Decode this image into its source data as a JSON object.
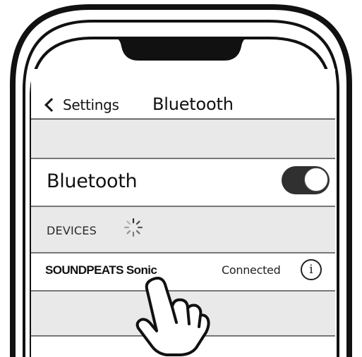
{
  "nav": {
    "back_label": "Settings",
    "title": "Bluetooth"
  },
  "bluetooth_toggle": {
    "label": "Bluetooth",
    "state": "on"
  },
  "devices_section": {
    "header": "DEVICES",
    "searching": true
  },
  "devices": [
    {
      "name": "SOUNDPEATS Sonic",
      "status": "Connected",
      "info_icon": "i"
    }
  ],
  "icons": {
    "back": "chevron-left-icon",
    "spinner": "loading-spinner-icon",
    "info": "info-icon",
    "hand": "tap-hand-icon"
  },
  "colors": {
    "toggle_on": "#303030",
    "background": "#f1f1f1",
    "separator": "#777777"
  }
}
